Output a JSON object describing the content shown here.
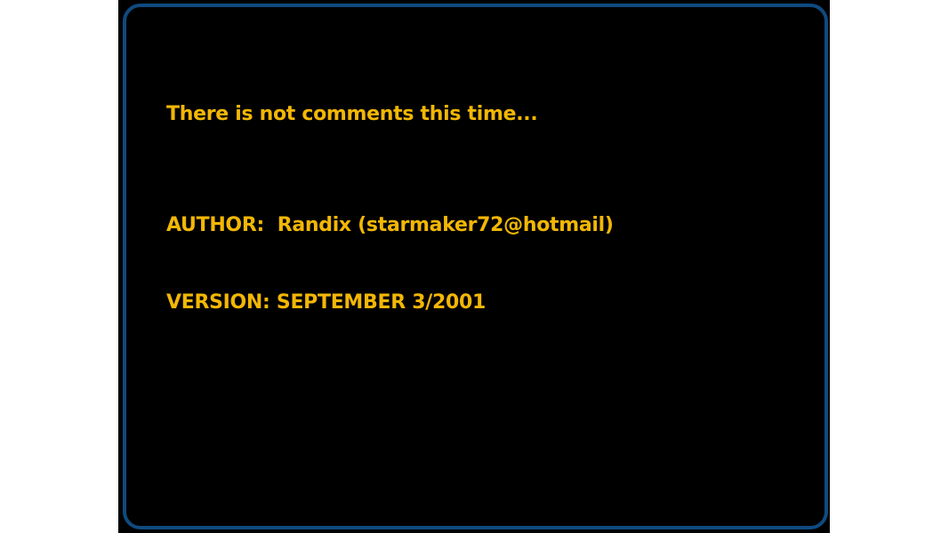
{
  "screen": {
    "comment": "There is not comments this time...",
    "author_line": "AUTHOR:  Randix (starmaker72@hotmail)",
    "version_line": "VERSION: SEPTEMBER 3/2001"
  },
  "colors": {
    "background": "#000000",
    "frame_border": "#0f4a80",
    "text": "#f2b705",
    "page_margin": "#ffffff"
  }
}
